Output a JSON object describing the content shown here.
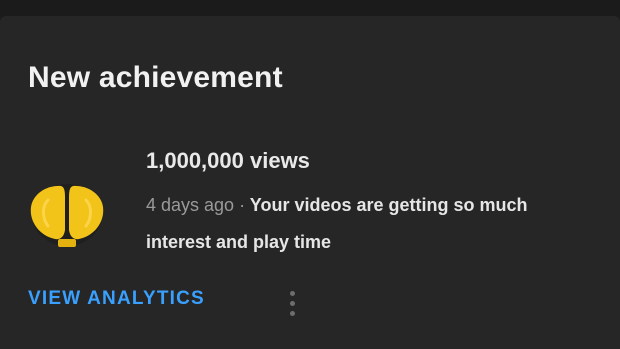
{
  "card": {
    "title": "New achievement",
    "icon": "trophy-icon",
    "accent_color": "#f2c318",
    "headline": "1,000,000 views",
    "time": "4 days ago",
    "separator": "·",
    "message": "Your videos are getting so much interest and play time",
    "action_label": "VIEW ANALYTICS",
    "action_color": "#3aa0ff",
    "more_icon": "more-vertical-icon"
  }
}
